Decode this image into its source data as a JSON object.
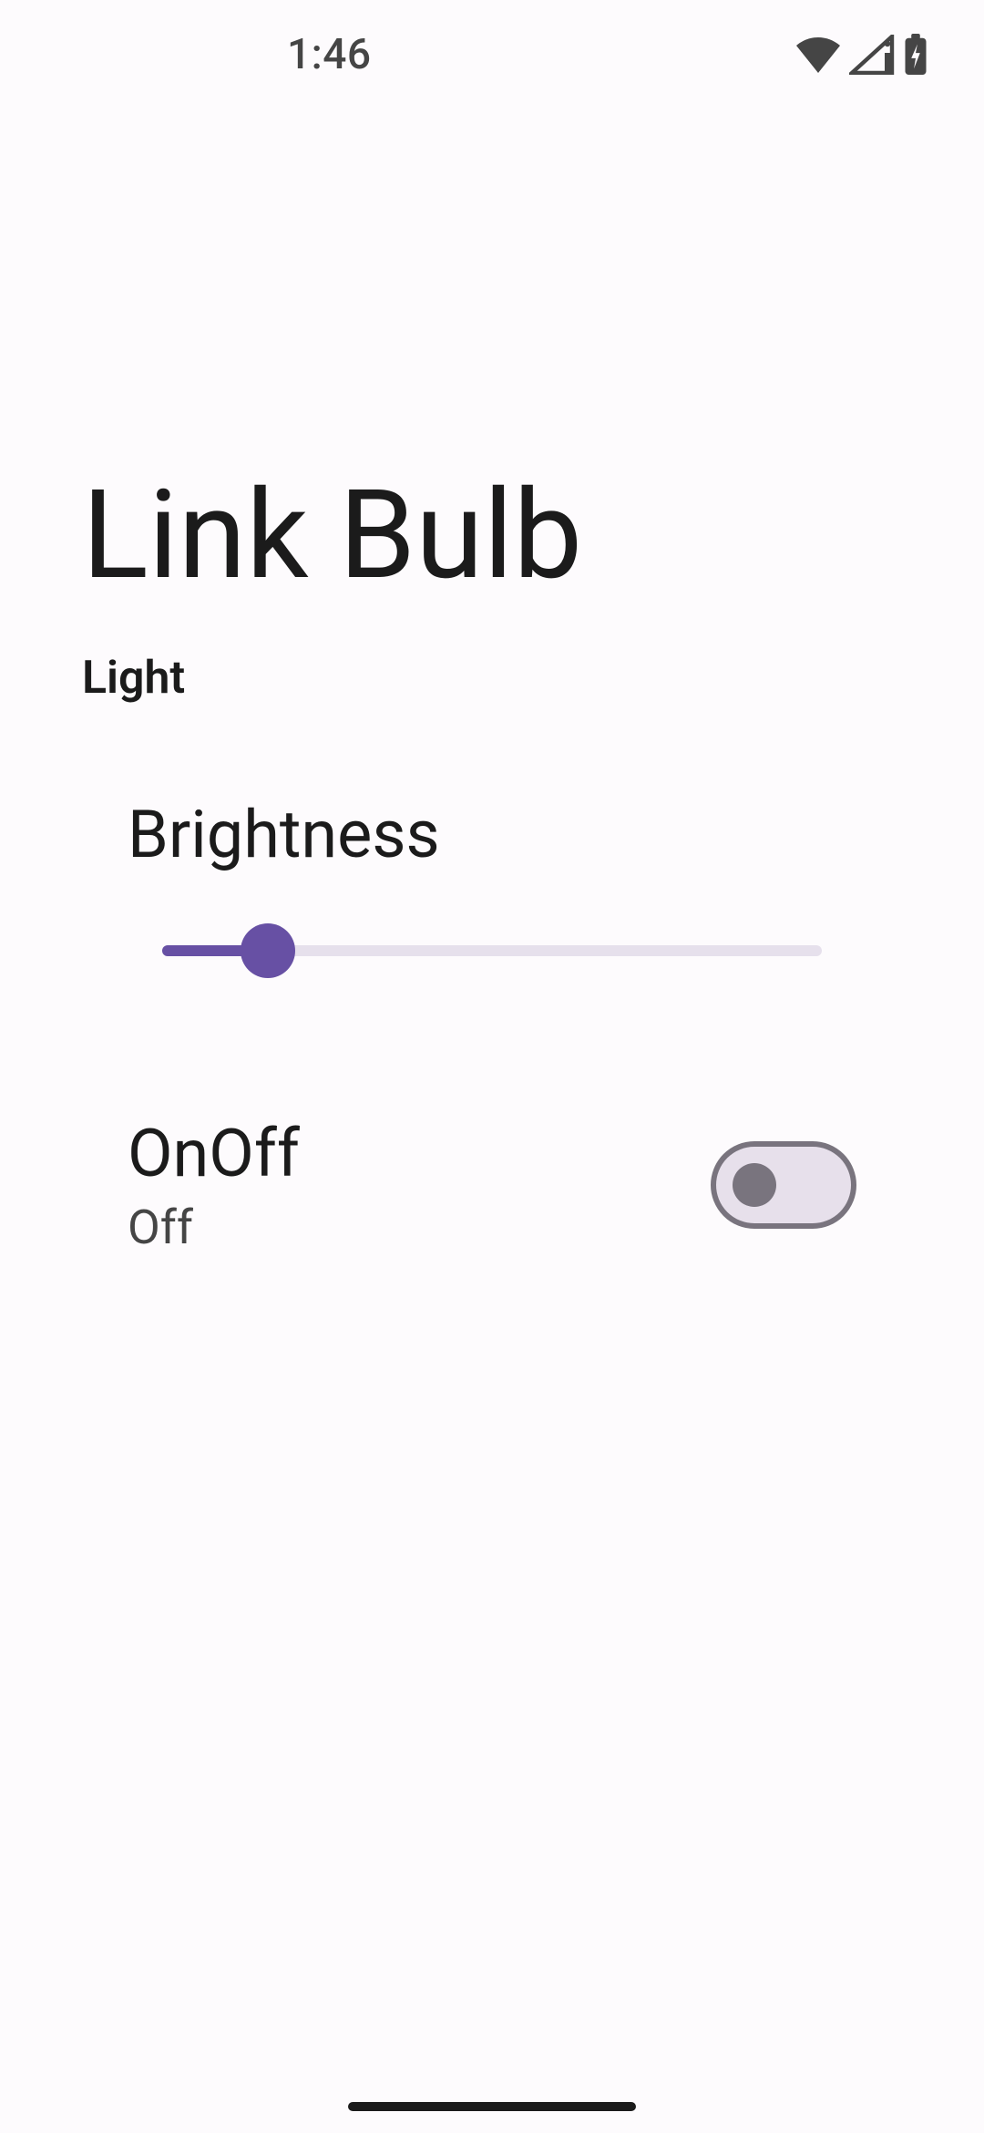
{
  "status": {
    "time": "1:46"
  },
  "page": {
    "title": "Link Bulb",
    "subtitle": "Light"
  },
  "brightness": {
    "label": "Brightness",
    "value_percent": 16
  },
  "onoff": {
    "title": "OnOff",
    "state": "Off",
    "on": false
  },
  "colors": {
    "accent": "#6750a4",
    "track": "#e6e0ec",
    "switch_bg": "#e7e0eb",
    "switch_border": "#79747e"
  }
}
